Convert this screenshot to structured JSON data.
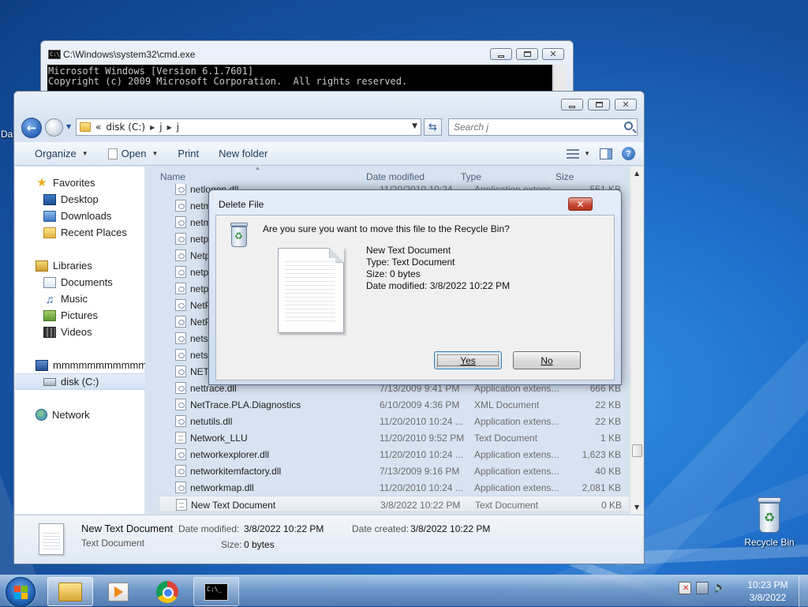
{
  "cmd": {
    "title": "C:\\Windows\\system32\\cmd.exe",
    "line1": "Microsoft Windows [Version 6.1.7601]",
    "line2": "Copyright (c) 2009 Microsoft Corporation.  All rights reserved."
  },
  "explorer": {
    "breadcrumb": {
      "overflow": "«",
      "drive": "disk (C:)",
      "folder1": "j",
      "folder2": "j"
    },
    "search_placeholder": "Search j",
    "toolbar": {
      "organize": "Organize",
      "open": "Open",
      "print": "Print",
      "new_folder": "New folder"
    },
    "nav": {
      "favorites": "Favorites",
      "desktop": "Desktop",
      "downloads": "Downloads",
      "recent_places": "Recent Places",
      "libraries": "Libraries",
      "documents": "Documents",
      "music": "Music",
      "pictures": "Pictures",
      "videos": "Videos",
      "computer": "mmmmmmmmmmmn",
      "disk": "disk (C:)",
      "network": "Network"
    },
    "columns": {
      "name": "Name",
      "date": "Date modified",
      "type": "Type",
      "size": "Size"
    },
    "files": [
      {
        "name": "netlogon.dll",
        "date": "11/20/2010 10:24 ...",
        "type": "Application extens...",
        "size": "551 KB"
      },
      {
        "name": "netman.dll",
        "date": "",
        "type": "",
        "size": "KB"
      },
      {
        "name": "netmsg.dll",
        "date": "",
        "type": "",
        "size": "KB"
      },
      {
        "name": "netplwiz.dll",
        "date": "",
        "type": "",
        "size": "KB"
      },
      {
        "name": "Netplwiz",
        "date": "",
        "type": "",
        "size": "KB"
      },
      {
        "name": "netprof",
        "date": "",
        "type": "",
        "size": "KB"
      },
      {
        "name": "netprofm.dll",
        "date": "",
        "type": "",
        "size": "KB"
      },
      {
        "name": "NetProj",
        "date": "",
        "type": "",
        "size": "KB"
      },
      {
        "name": "NetProjW",
        "date": "",
        "type": "",
        "size": "KB"
      },
      {
        "name": "netsh",
        "date": "",
        "type": "",
        "size": "KB"
      },
      {
        "name": "netshell.dll",
        "date": "",
        "type": "",
        "size": "KB"
      },
      {
        "name": "NETSTAT",
        "date": "",
        "type": "",
        "size": "KB"
      },
      {
        "name": "nettrace.dll",
        "date": "7/13/2009 9:41 PM",
        "type": "Application extens...",
        "size": "666 KB"
      },
      {
        "name": "NetTrace.PLA.Diagnostics",
        "date": "6/10/2009 4:36 PM",
        "type": "XML Document",
        "size": "22 KB"
      },
      {
        "name": "netutils.dll",
        "date": "11/20/2010 10:24 ...",
        "type": "Application extens...",
        "size": "22 KB"
      },
      {
        "name": "Network_LLU",
        "date": "11/20/2010 9:52 PM",
        "type": "Text Document",
        "size": "1 KB"
      },
      {
        "name": "networkexplorer.dll",
        "date": "11/20/2010 10:24 ...",
        "type": "Application extens...",
        "size": "1,623 KB"
      },
      {
        "name": "networkitemfactory.dll",
        "date": "7/13/2009 9:16 PM",
        "type": "Application extens...",
        "size": "40 KB"
      },
      {
        "name": "networkmap.dll",
        "date": "11/20/2010 10:24 ...",
        "type": "Application extens...",
        "size": "2,081 KB"
      },
      {
        "name": "New Text Document",
        "date": "3/8/2022 10:22 PM",
        "type": "Text Document",
        "size": "0 KB"
      }
    ],
    "details": {
      "name": "New Text Document",
      "type": "Text Document",
      "date_modified_label": "Date modified:",
      "date_modified": "3/8/2022 10:22 PM",
      "date_created_label": "Date created:",
      "date_created": "3/8/2022 10:22 PM",
      "size_label": "Size:",
      "size": "0 bytes"
    }
  },
  "dialog": {
    "title": "Delete File",
    "question": "Are you sure you want to move this file to the Recycle Bin?",
    "file_name": "New Text Document",
    "file_type": "Type: Text Document",
    "file_size": "Size: 0 bytes",
    "file_date": "Date modified: 3/8/2022 10:22 PM",
    "yes": "Yes",
    "no": "No"
  },
  "desktop": {
    "recycle_bin": "Recycle Bin",
    "left_fragment": "Da"
  },
  "taskbar": {
    "time": "10:23 PM",
    "date": "3/8/2022"
  },
  "colors": {
    "close_red": "#c74a35",
    "accent_blue": "#1f6fcb"
  }
}
